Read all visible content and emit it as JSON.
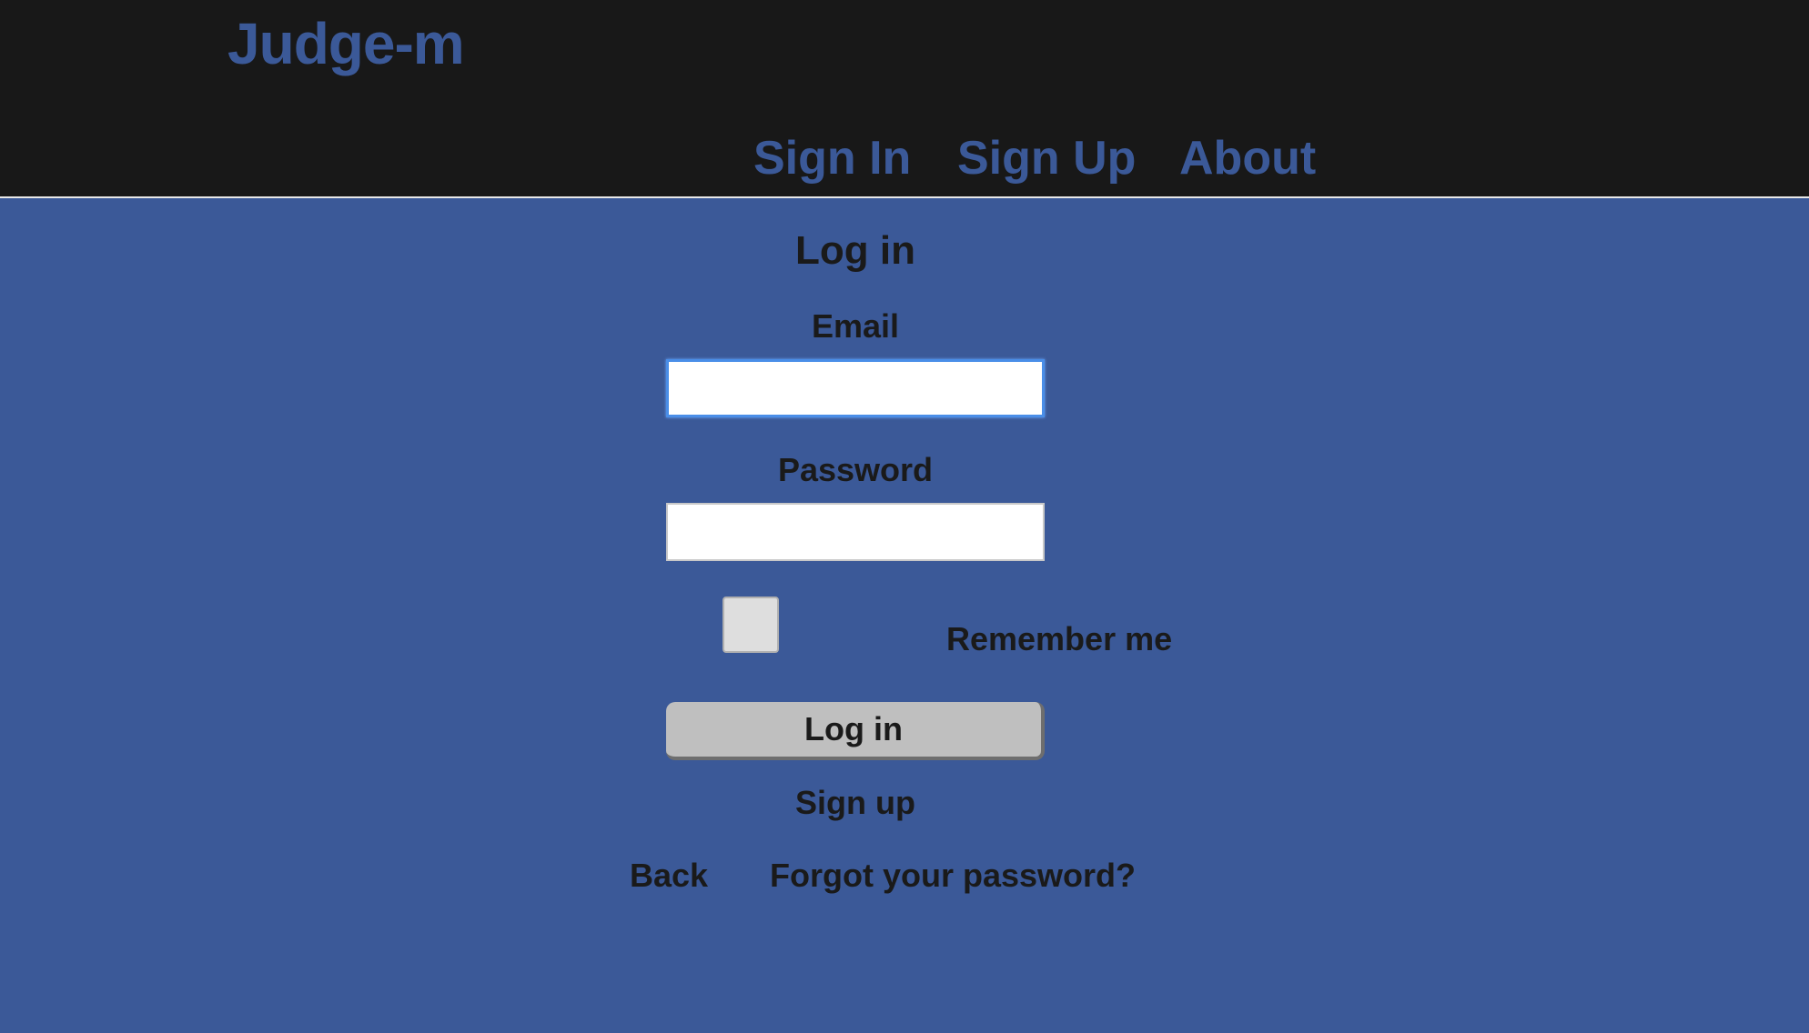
{
  "header": {
    "brand": "Judge-m",
    "nav": {
      "sign_in": "Sign In",
      "sign_up": "Sign Up",
      "about": "About"
    }
  },
  "form": {
    "title": "Log in",
    "email_label": "Email",
    "email_value": "",
    "password_label": "Password",
    "password_value": "",
    "remember_label": "Remember me",
    "remember_checked": false,
    "submit_label": "Log in"
  },
  "links": {
    "sign_up": "Sign up",
    "back": "Back",
    "forgot_password": "Forgot your password?"
  },
  "colors": {
    "page_background": "#3b5998",
    "header_background": "#181818",
    "brand_color": "#3b5998",
    "text_color": "#1a1a1a",
    "button_background": "#bfbfbf",
    "focus_ring": "#4a8ee8"
  }
}
